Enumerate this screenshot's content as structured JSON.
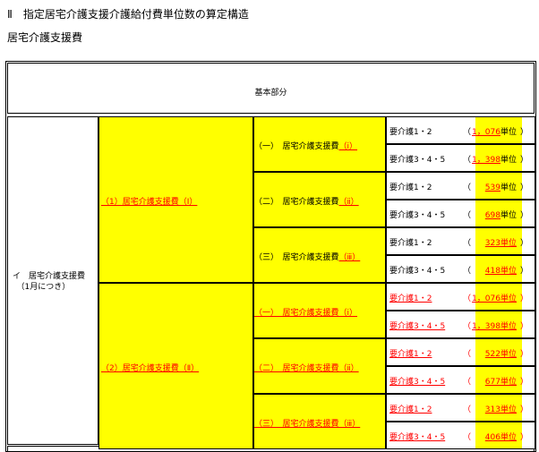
{
  "title": "Ⅱ　指定居宅介護支援介護給付費単位数の算定構造",
  "subtitle": "居宅介護支援費",
  "base_header": "基本部分",
  "main_item": "イ　居宅介護支援費\n　（1月につき）",
  "groups": [
    {
      "label": "（1）居宅介護支援費（Ⅰ）",
      "subs": [
        {
          "label": "（一）　居宅介護支援費（ⅰ）",
          "rows": [
            {
              "care": "要介護1・2",
              "value": "1，076",
              "unit": "単位"
            },
            {
              "care": "要介護3・4・5",
              "value": "1，398",
              "unit": "単位"
            }
          ]
        },
        {
          "label": "（二）　居宅介護支援費（ⅱ）",
          "rows": [
            {
              "care": "要介護1・2",
              "value": "539",
              "unit": "単位"
            },
            {
              "care": "要介護3・4・5",
              "value": "698",
              "unit": "単位"
            }
          ]
        },
        {
          "label": "（三）　居宅介護支援費（ⅲ）",
          "rows": [
            {
              "care": "要介護1・2",
              "value": "323",
              "unit": "単位"
            },
            {
              "care": "要介護3・4・5",
              "value": "418",
              "unit": "単位"
            }
          ]
        }
      ]
    },
    {
      "label": "（2）居宅介護支援費（Ⅱ）",
      "subs": [
        {
          "label": "（一）　居宅介護支援費（ⅰ）",
          "rows": [
            {
              "care": "要介護1・2",
              "value": "1，076",
              "unit": "単位"
            },
            {
              "care": "要介護3・4・5",
              "value": "1，398",
              "unit": "単位"
            }
          ]
        },
        {
          "label": "（二）　居宅介護支援費（ⅱ）",
          "rows": [
            {
              "care": "要介護1・2",
              "value": "522",
              "unit": "単位"
            },
            {
              "care": "要介護3・4・5",
              "value": "677",
              "unit": "単位"
            }
          ]
        },
        {
          "label": "（三）　居宅介護支援費（ⅲ）",
          "rows": [
            {
              "care": "要介護1・2",
              "value": "313",
              "unit": "単位"
            },
            {
              "care": "要介護3・4・5",
              "value": "406",
              "unit": "単位"
            }
          ]
        }
      ]
    }
  ],
  "colors": {
    "highlight": "#ffff00",
    "revision": "#ff0000"
  }
}
